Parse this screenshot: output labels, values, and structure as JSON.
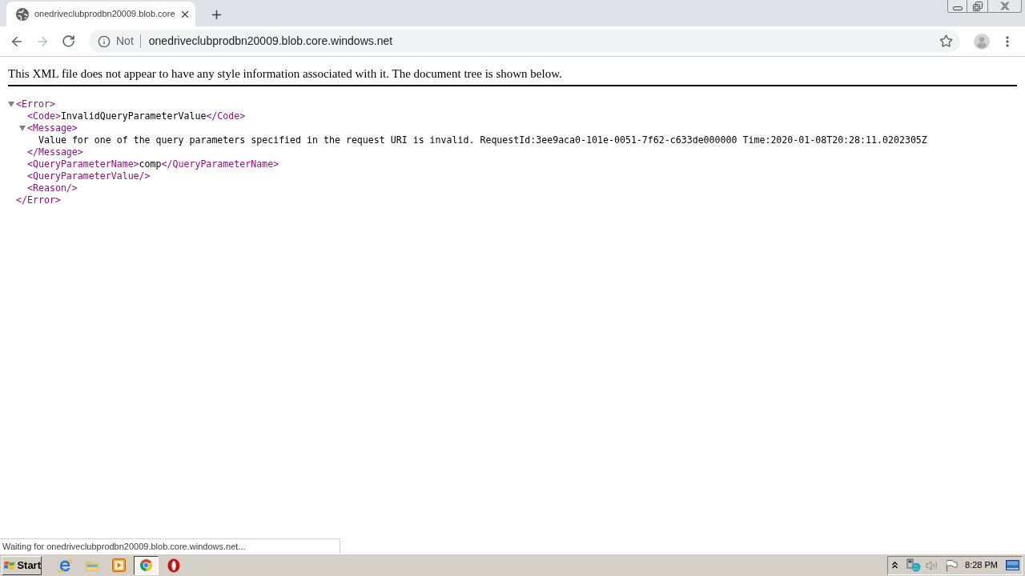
{
  "window": {
    "tabs": [
      {
        "title": "onedriveclubprodbn20009.blob.core",
        "selected": true
      }
    ]
  },
  "toolbar": {
    "nav_buttons": [
      {
        "kind": "back",
        "disabled": false
      },
      {
        "kind": "forward",
        "disabled": true
      },
      {
        "kind": "reload",
        "disabled": false
      }
    ],
    "omnibox": {
      "security_label": "Not",
      "url": "onedriveclubprodbn20009.blob.core.windows.net"
    }
  },
  "page": {
    "notice": "This XML file does not appear to have any style information associated with it. The document tree is shown below.",
    "xml_tree": [
      {
        "kind": "element",
        "open_tag": "<Error>",
        "close_tag": "</Error>",
        "expanded": true,
        "children": [
          {
            "kind": "inline",
            "open_tag": "<Code>",
            "text": "InvalidQueryParameterValue",
            "close_tag": "</Code>"
          },
          {
            "kind": "element",
            "open_tag": "<Message>",
            "close_tag": "</Message>",
            "expanded": true,
            "children": [
              {
                "kind": "text",
                "text": "Value for one of the query parameters specified in the request URI is invalid. RequestId:3ee9aca0-101e-0051-7f62-c633de000000 Time:2020-01-08T20:28:11.0202305Z"
              }
            ]
          },
          {
            "kind": "inline",
            "open_tag": "<QueryParameterName>",
            "text": "comp",
            "close_tag": "</QueryParameterName>"
          },
          {
            "kind": "empty",
            "tag": "<QueryParameterValue/>"
          },
          {
            "kind": "empty",
            "tag": "<Reason/>"
          }
        ]
      }
    ]
  },
  "status_bubble": "Waiting for onedriveclubprodbn20009.blob.core.windows.net...",
  "taskbar": {
    "start_label": "Start",
    "apps": [
      {
        "kind": "ie",
        "selected": false
      },
      {
        "kind": "folder",
        "selected": false
      },
      {
        "kind": "media",
        "selected": false
      },
      {
        "kind": "chrome",
        "selected": true
      },
      {
        "kind": "opera",
        "selected": false
      }
    ],
    "clock": "8:28 PM"
  }
}
